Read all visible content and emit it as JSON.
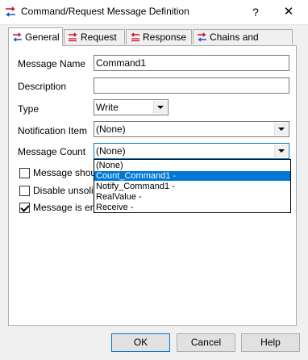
{
  "window": {
    "title": "Command/Request Message Definition",
    "help": "?",
    "close": "✕"
  },
  "tabs": [
    {
      "label": "General",
      "active": true
    },
    {
      "label": "Request"
    },
    {
      "label": "Response"
    },
    {
      "label": "Chains and Triggers"
    }
  ],
  "form": {
    "message_name_label": "Message Name",
    "message_name_value": "Command1",
    "description_label": "Description",
    "description_value": "",
    "type_label": "Type",
    "type_value": "Write",
    "notification_item_label": "Notification Item",
    "notification_item_value": "(None)",
    "message_count_label": "Message Count",
    "message_count_value": "(None)"
  },
  "checkboxes": [
    {
      "label": "Message shoulc",
      "checked": false
    },
    {
      "label": "Disable unsolici",
      "checked": false
    },
    {
      "label": "Message is enal",
      "checked": true
    }
  ],
  "dropdown_options": [
    {
      "label": "(None)"
    },
    {
      "label": "Count_Command1 -",
      "selected": true
    },
    {
      "label": "Notify_Command1 -"
    },
    {
      "label": "RealValue -"
    },
    {
      "label": "Receive -"
    }
  ],
  "buttons": {
    "ok": "OK",
    "cancel": "Cancel",
    "help": "Help"
  },
  "colors": {
    "accent": "#0078d7",
    "icon_red": "#c8102e",
    "icon_blue": "#1f4fbf"
  }
}
